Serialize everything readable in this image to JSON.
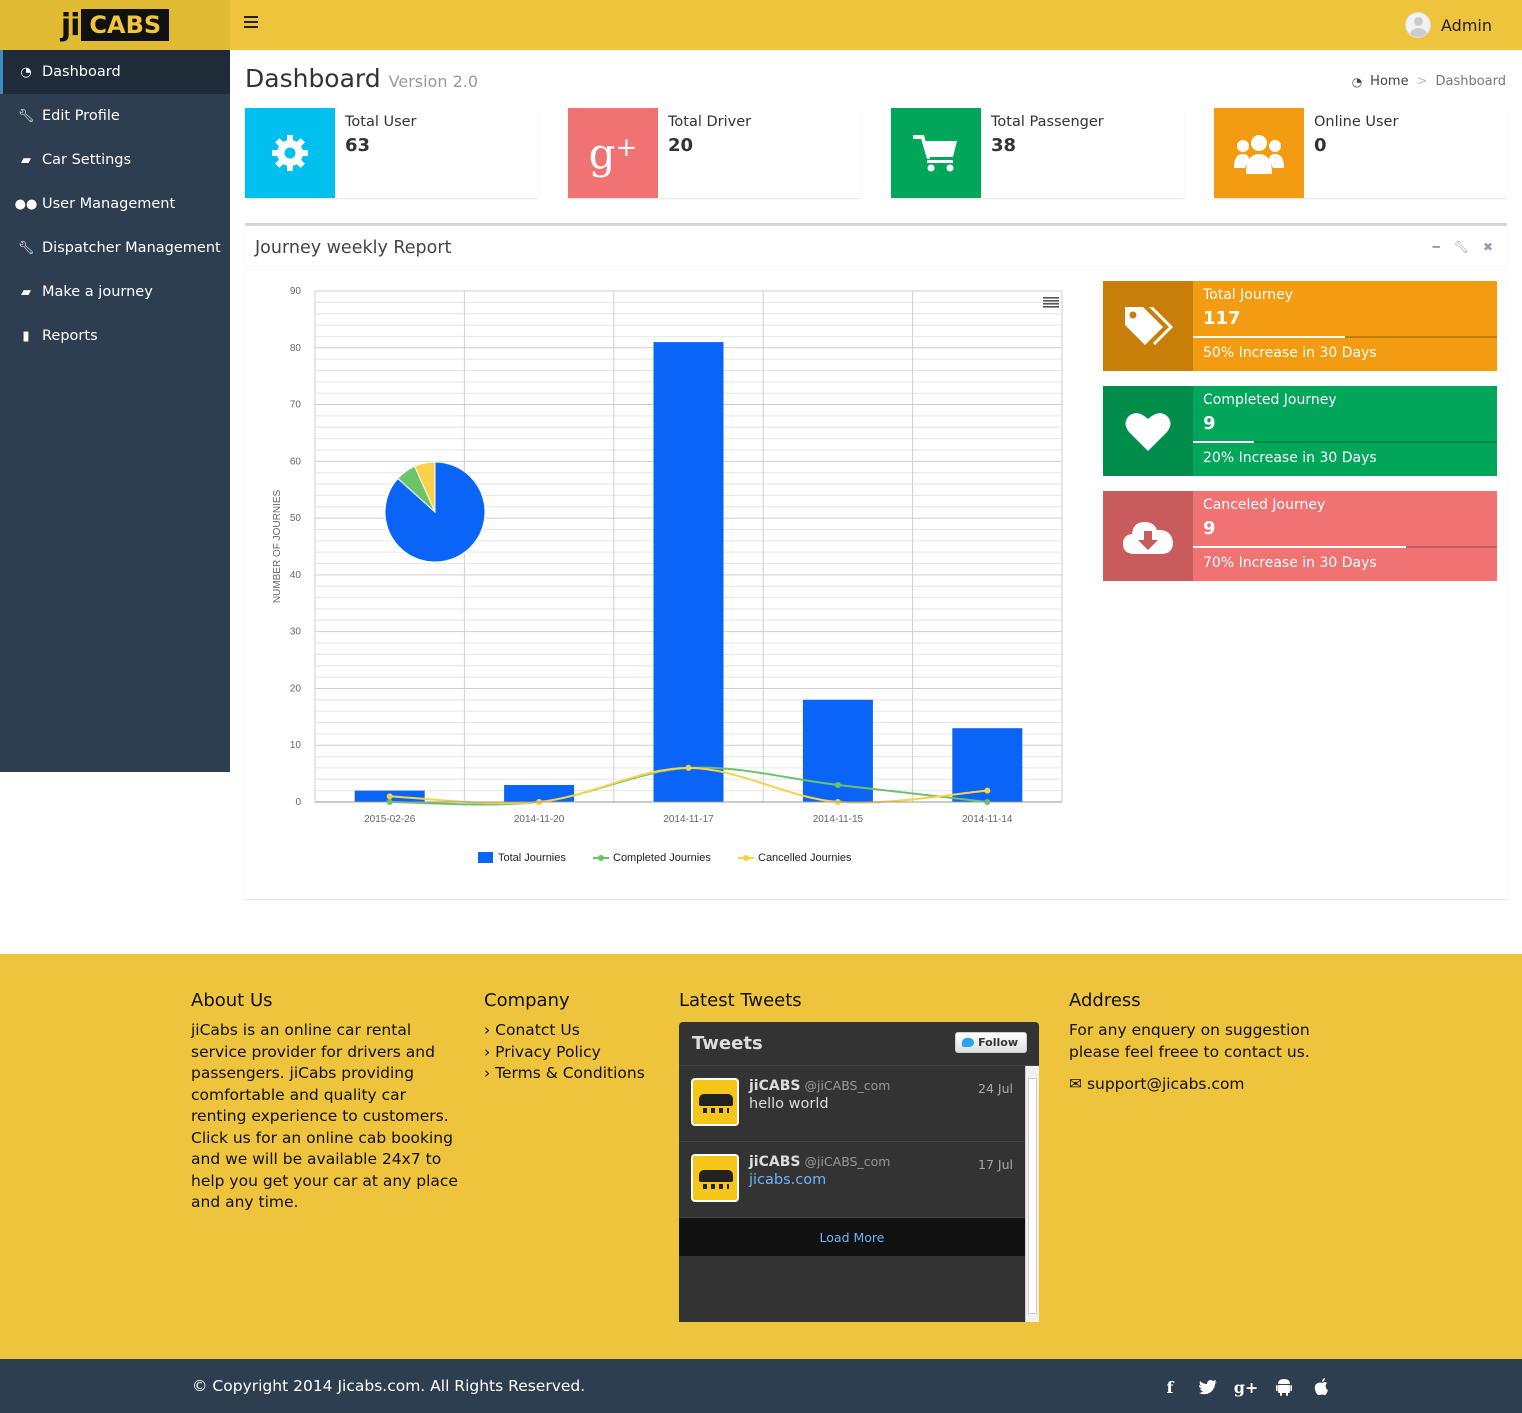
{
  "logo": {
    "ji": "ji",
    "cabs": "CABS"
  },
  "header": {
    "user": "Admin"
  },
  "sidebar": {
    "items": [
      {
        "label": "Dashboard",
        "icon": "dashboard-icon"
      },
      {
        "label": "Edit Profile",
        "icon": "wrench-icon"
      },
      {
        "label": "Car Settings",
        "icon": "car-icon"
      },
      {
        "label": "User Management",
        "icon": "users-icon"
      },
      {
        "label": "Dispatcher Management",
        "icon": "wrench-icon"
      },
      {
        "label": "Make a journey",
        "icon": "car-icon"
      },
      {
        "label": "Reports",
        "icon": "bar-chart-icon"
      }
    ]
  },
  "page": {
    "title": "Dashboard",
    "subtitle": "Version 2.0"
  },
  "breadcrumb": {
    "home": "Home",
    "sep": ">",
    "current": "Dashboard"
  },
  "info_boxes": [
    {
      "label": "Total User",
      "value": "63",
      "color": "#00c0ef",
      "icon": "gear-icon"
    },
    {
      "label": "Total Driver",
      "value": "20",
      "color": "#f17272",
      "icon": "google-plus-icon"
    },
    {
      "label": "Total Passenger",
      "value": "38",
      "color": "#00a65a",
      "icon": "cart-icon"
    },
    {
      "label": "Online User",
      "value": "0",
      "color": "#f39c12",
      "icon": "users-icon"
    }
  ],
  "report": {
    "title": "Journey weekly Report"
  },
  "chart_data": {
    "type": "bar",
    "categories": [
      "2015-02-26",
      "2014-11-20",
      "2014-11-17",
      "2014-11-15",
      "2014-11-14"
    ],
    "series": [
      {
        "name": "Total Journies",
        "type": "bar",
        "color": "#0a64f8",
        "values": [
          2,
          3,
          81,
          18,
          13
        ]
      },
      {
        "name": "Completed Journies",
        "type": "line",
        "color": "#6cc36a",
        "values": [
          0,
          0,
          6,
          3,
          0
        ]
      },
      {
        "name": "Cancelled Journies",
        "type": "line",
        "color": "#fcd047",
        "values": [
          1,
          0,
          6,
          0,
          2
        ]
      }
    ],
    "ylabel": "NUMBER OF JOURNIES",
    "ylim": [
      0,
      90
    ],
    "yticks": [
      "0",
      "10",
      "20",
      "30",
      "40",
      "50",
      "60",
      "70",
      "80",
      "90"
    ],
    "pie": [
      {
        "name": "Total Journies",
        "value": 117,
        "color": "#0a64f8"
      },
      {
        "name": "Completed Journies",
        "value": 9,
        "color": "#6cc36a"
      },
      {
        "name": "Cancelled Journies",
        "value": 9,
        "color": "#fcd047"
      }
    ],
    "legend": "bottom"
  },
  "stats": [
    {
      "label": "Total Journey",
      "value": "117",
      "desc": "50% Increase in 30 Days",
      "progress": 0.5,
      "color": "#f39c12",
      "icon_bg": "#c87f0a",
      "icon": "tags-icon"
    },
    {
      "label": "Completed Journey",
      "value": "9",
      "desc": "20% Increase in 30 Days",
      "progress": 0.2,
      "color": "#00a65a",
      "icon_bg": "#008d4c",
      "icon": "heart-icon"
    },
    {
      "label": "Canceled Journey",
      "value": "9",
      "desc": "70% Increase in 30 Days",
      "progress": 0.7,
      "color": "#f17272",
      "icon_bg": "#c85c5c",
      "icon": "cloud-download-icon"
    }
  ],
  "footer": {
    "about": {
      "title": "About Us",
      "text": "jiCabs is an online car rental service provider for drivers and passengers. jiCabs providing comfortable and quality car renting experience to customers. Click us for an online cab booking and we will be available 24x7 to help you get your car at any place and any time."
    },
    "company": {
      "title": "Company",
      "links": [
        "Conatct Us",
        "Privacy Policy",
        "Terms & Conditions"
      ]
    },
    "tweets": {
      "title": "Latest Tweets",
      "widget_title": "Tweets",
      "follow": "Follow",
      "items": [
        {
          "name": "jiCABS",
          "handle": "@jiCABS_com",
          "date": "24 Jul",
          "text": "hello world"
        },
        {
          "name": "jiCABS",
          "handle": "@jiCABS_com",
          "date": "17 Jul",
          "text": "jicabs.com"
        }
      ],
      "load_more": "Load More"
    },
    "address": {
      "title": "Address",
      "text": "For any enquery on suggestion please feel freee to contact us.",
      "email": "support@jicabs.com"
    }
  },
  "bottom": {
    "copyright": "© Copyright 2014 Jicabs.com. All Rights Reserved.",
    "social": [
      "facebook-icon",
      "twitter-icon",
      "google-plus-icon",
      "android-icon",
      "apple-icon"
    ]
  }
}
